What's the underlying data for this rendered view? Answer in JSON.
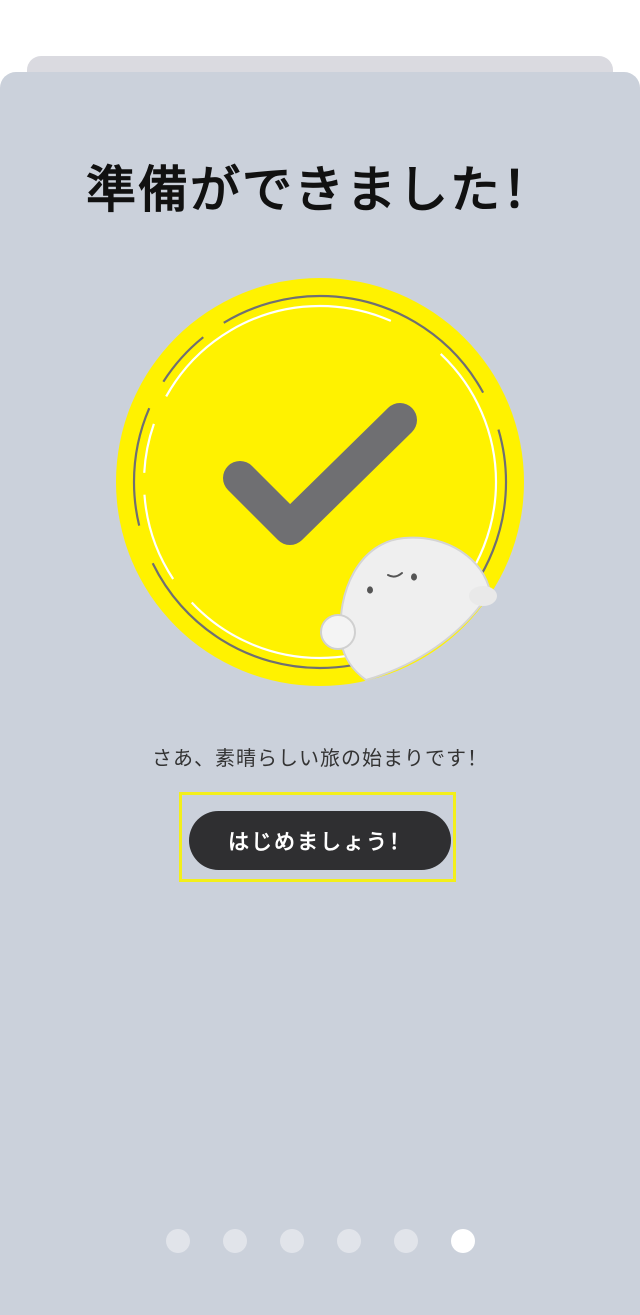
{
  "title": "準備ができました！",
  "subtitle": "さあ、素晴らしい旅の始まりです！",
  "start_button_label": "はじめましょう！",
  "pagination": {
    "total": 6,
    "active_index": 5
  },
  "colors": {
    "background": "#cbd1db",
    "accent_yellow": "#fff200",
    "checkmark": "#6f6f72",
    "button": "#2f2f31"
  },
  "icons": {
    "hero": "checkmark-icon",
    "mascot": "mascot-character"
  }
}
